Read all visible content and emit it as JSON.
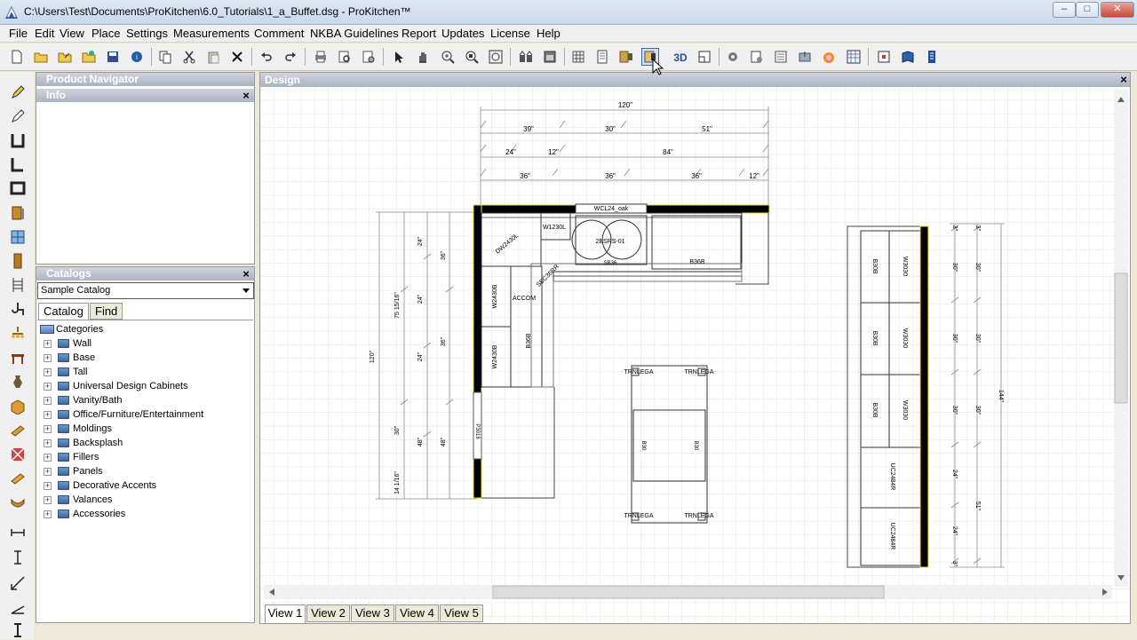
{
  "window": {
    "title": "C:\\Users\\Test\\Documents\\ProKitchen\\6.0_Tutorials\\1_a_Buffet.dsg - ProKitchen™",
    "controls": [
      "–",
      "□",
      "✕"
    ]
  },
  "menu": [
    "File",
    "Edit",
    "View",
    "Place",
    "Settings",
    "Measurements",
    "Comment",
    "NKBA Guidelines",
    "Report",
    "Updates",
    "License",
    "Help"
  ],
  "panels": {
    "product_navigator": "Product Navigator",
    "info": "Info",
    "catalogs": "Catalogs",
    "catalog_select": "Sample Catalog",
    "tabs": [
      "Catalog",
      "Find"
    ],
    "tree_root": "Categories",
    "categories": [
      "Wall",
      "Base",
      "Tall",
      "Universal Design Cabinets",
      "Vanity/Bath",
      "Office/Furniture/Entertainment",
      "Moldings",
      "Backsplash",
      "Fillers",
      "Panels",
      "Decorative Accents",
      "Valances",
      "Accessories"
    ]
  },
  "design": {
    "header": "Design",
    "view_tabs": [
      "View 1",
      "View 2",
      "View 3",
      "View 4",
      "View 5"
    ],
    "top_dims": {
      "row1": [
        "120\""
      ],
      "row2": [
        "39\"",
        "30\"",
        "51\""
      ],
      "row3": [
        "24\"",
        "12\"",
        "84\""
      ],
      "row4": [
        "36\"",
        "36\"",
        "36\"",
        "12\""
      ]
    },
    "left_dims": [
      "120\"",
      "75 15/16\"",
      "24\"",
      "24\"",
      "24\"",
      "30\"",
      "14 1/16\"",
      "36\"",
      "36\"",
      "48\"",
      "48\""
    ],
    "right_dims": [
      "3\"",
      "30\"",
      "30\"",
      "30\"",
      "24\"",
      "24\"",
      "3\"",
      "3\"",
      "30\"",
      "30\"",
      "30\"",
      "51\"",
      "144\""
    ],
    "cabinets": {
      "wcl": "WCL24_oak",
      "dw": "DW2430L",
      "w1230": "W1230L",
      "sink": "2BSRS-01",
      "sink_label": "SB36",
      "b36": "B36B",
      "sbc": "SBC36RR",
      "accom": "ACCOM",
      "w2430a": "W2430B",
      "w2430b": "W2430B",
      "b36b2": "B36B",
      "pantry": "P3018",
      "b30": [
        "B30B",
        "B30B",
        "B30B"
      ],
      "w3030": [
        "W3030",
        "W3030",
        "W3030"
      ],
      "uc": [
        "UC2484R",
        "UC2484R"
      ],
      "island_legs": [
        "TRNLEGA",
        "TRNLEGA",
        "TRNLEGA",
        "TRNLEGA"
      ],
      "island_b30": [
        "B30",
        "B30"
      ]
    }
  },
  "colors": {
    "wall": "#000000",
    "wall_edge": "#f0e020",
    "grid": "#e0e0e0",
    "dim": "#8a8a8a",
    "panel_header": "#b7bfcb"
  }
}
